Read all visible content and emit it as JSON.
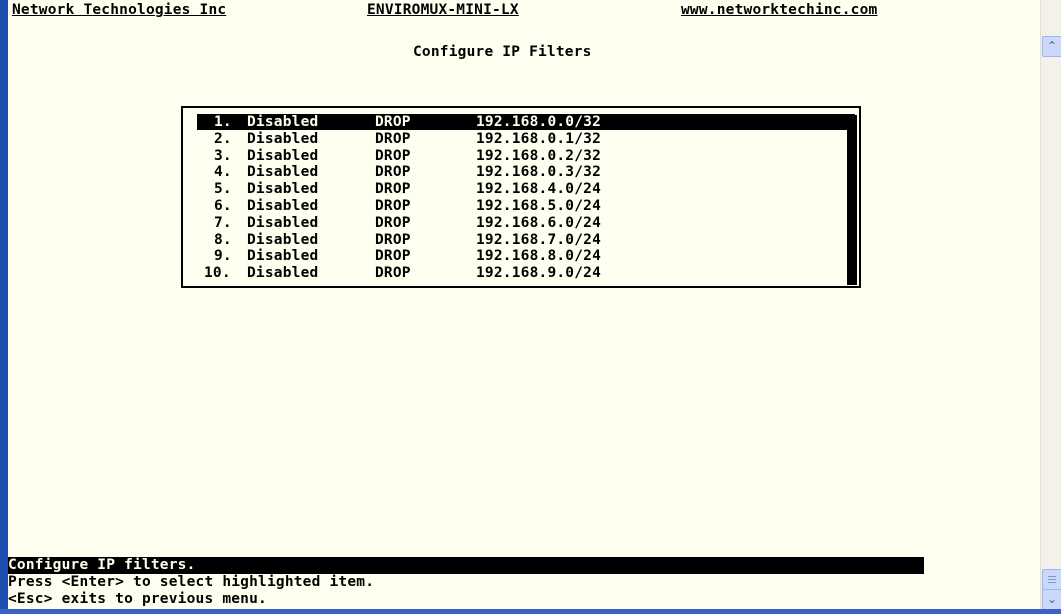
{
  "header": {
    "company": "Network Technologies Inc",
    "product": "ENVIROMUX-MINI-LX",
    "website": "www.networktechinc.com"
  },
  "page_title": "Configure IP Filters",
  "filters": [
    {
      "num": "1.",
      "state": "Disabled",
      "action": "DROP",
      "address": "192.168.0.0/32"
    },
    {
      "num": "2.",
      "state": "Disabled",
      "action": "DROP",
      "address": "192.168.0.1/32"
    },
    {
      "num": "3.",
      "state": "Disabled",
      "action": "DROP",
      "address": "192.168.0.2/32"
    },
    {
      "num": "4.",
      "state": "Disabled",
      "action": "DROP",
      "address": "192.168.0.3/32"
    },
    {
      "num": "5.",
      "state": "Disabled",
      "action": "DROP",
      "address": "192.168.4.0/24"
    },
    {
      "num": "6.",
      "state": "Disabled",
      "action": "DROP",
      "address": "192.168.5.0/24"
    },
    {
      "num": "7.",
      "state": "Disabled",
      "action": "DROP",
      "address": "192.168.6.0/24"
    },
    {
      "num": "8.",
      "state": "Disabled",
      "action": "DROP",
      "address": "192.168.7.0/24"
    },
    {
      "num": "9.",
      "state": "Disabled",
      "action": "DROP",
      "address": "192.168.8.0/24"
    },
    {
      "num": "10.",
      "state": "Disabled",
      "action": "DROP",
      "address": "192.168.9.0/24"
    }
  ],
  "selected_index": 0,
  "status_line": "Configure IP filters.",
  "help_lines": [
    "Press <Enter> to select highlighted item.",
    "<Esc> exits to previous menu."
  ],
  "scrollbar": {
    "up_icon": "chevron-up-icon",
    "down_icon": "chevron-down-icon",
    "up_glyph": "⌃",
    "down_glyph": "⌄"
  },
  "colors": {
    "terminal_bg": "#fffff0",
    "text": "#000000",
    "highlight_bg": "#000000",
    "window_frame": "#1f4fae"
  }
}
